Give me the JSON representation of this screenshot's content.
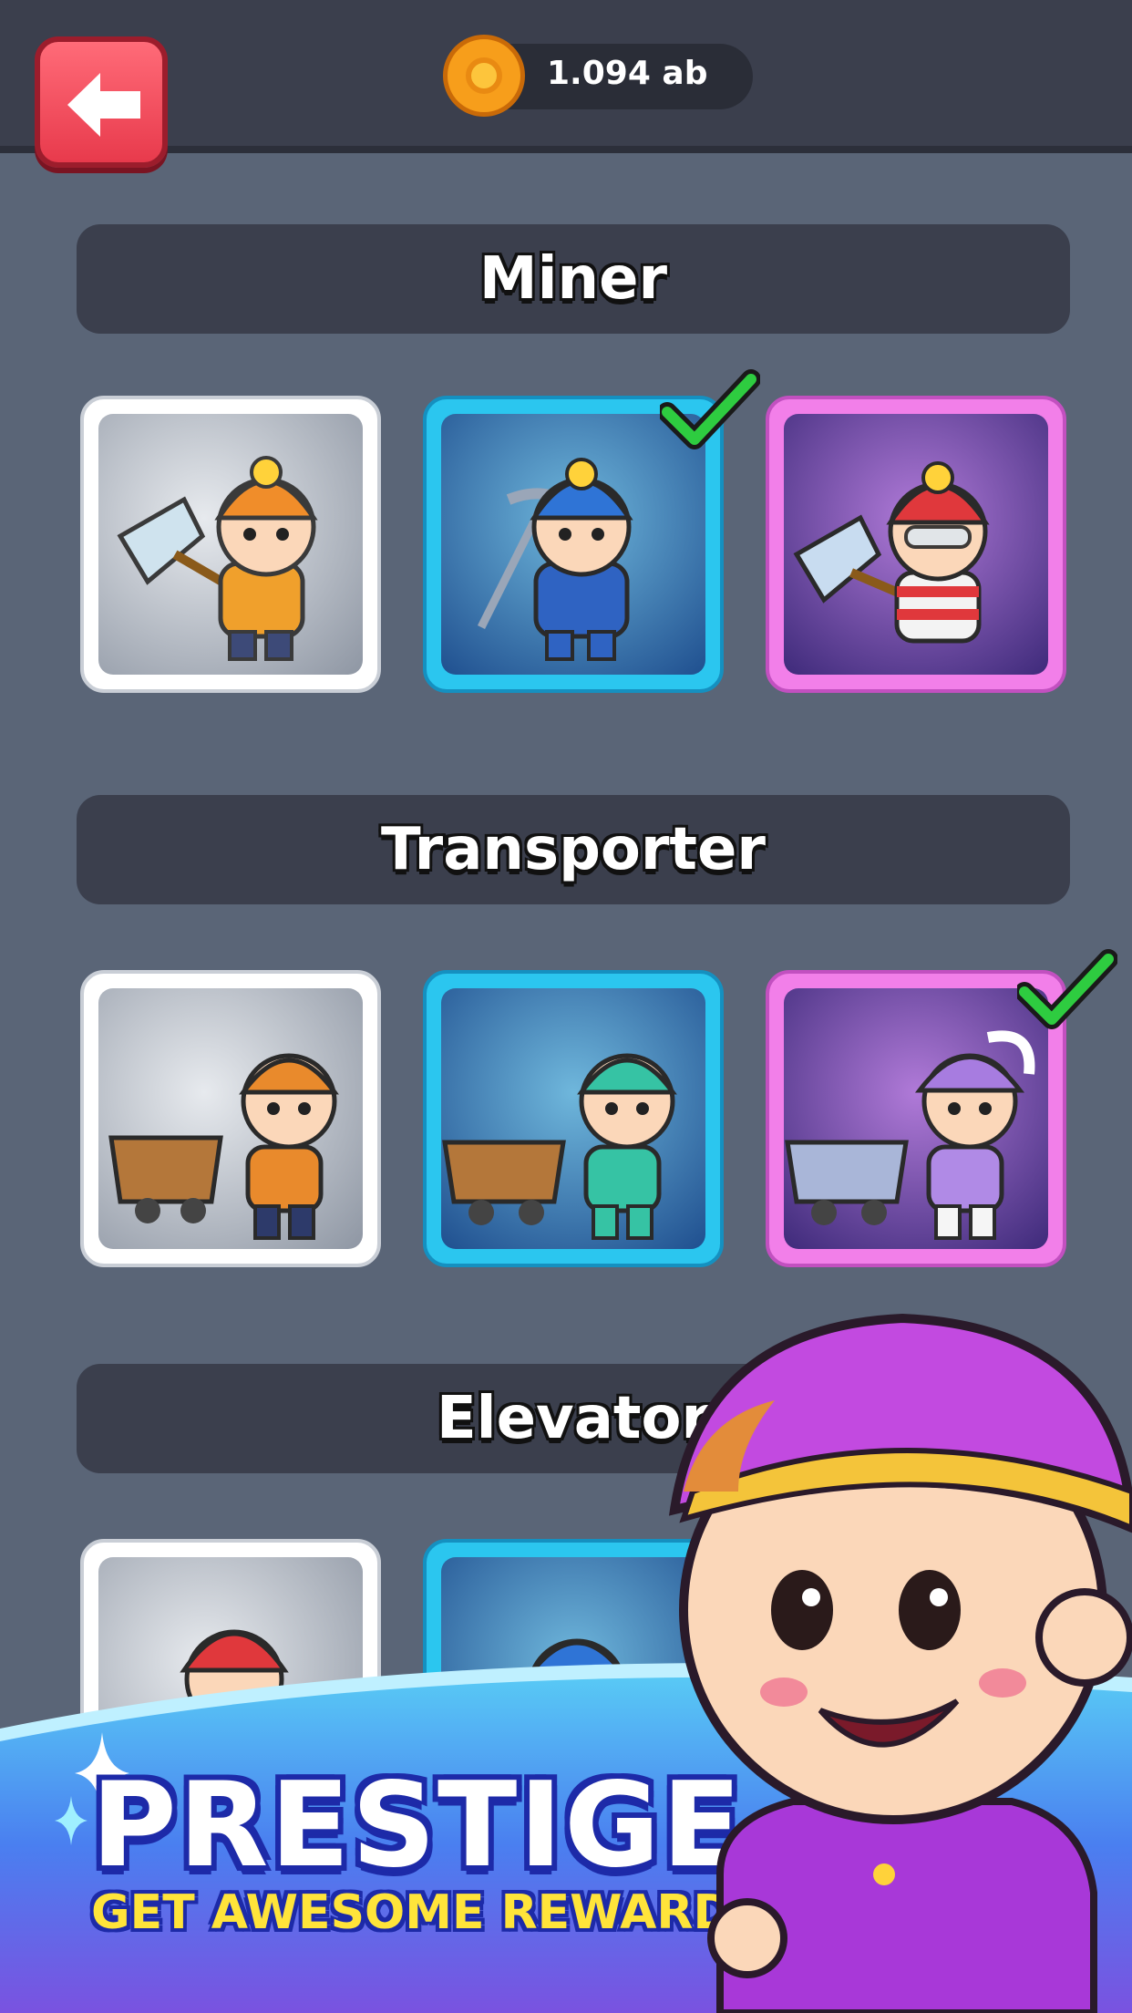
{
  "header": {
    "coins": "1.094 ab"
  },
  "sections": [
    {
      "title": "Miner"
    },
    {
      "title": "Transporter"
    },
    {
      "title": "Elevator"
    }
  ],
  "promo": {
    "title": "PRESTIGE",
    "subtitle": "GET AWESOME REWARDS"
  },
  "colors": {
    "background": "#5a6577",
    "panel": "#3b3f4d",
    "tier_common": "#ffffff",
    "tier_rare": "#2bc6ef",
    "tier_epic": "#f27fe9",
    "selected_check": "#2ecc40"
  },
  "icons": {
    "back": "back-arrow-icon",
    "coin": "coin-icon",
    "selected": "checkmark-icon"
  }
}
